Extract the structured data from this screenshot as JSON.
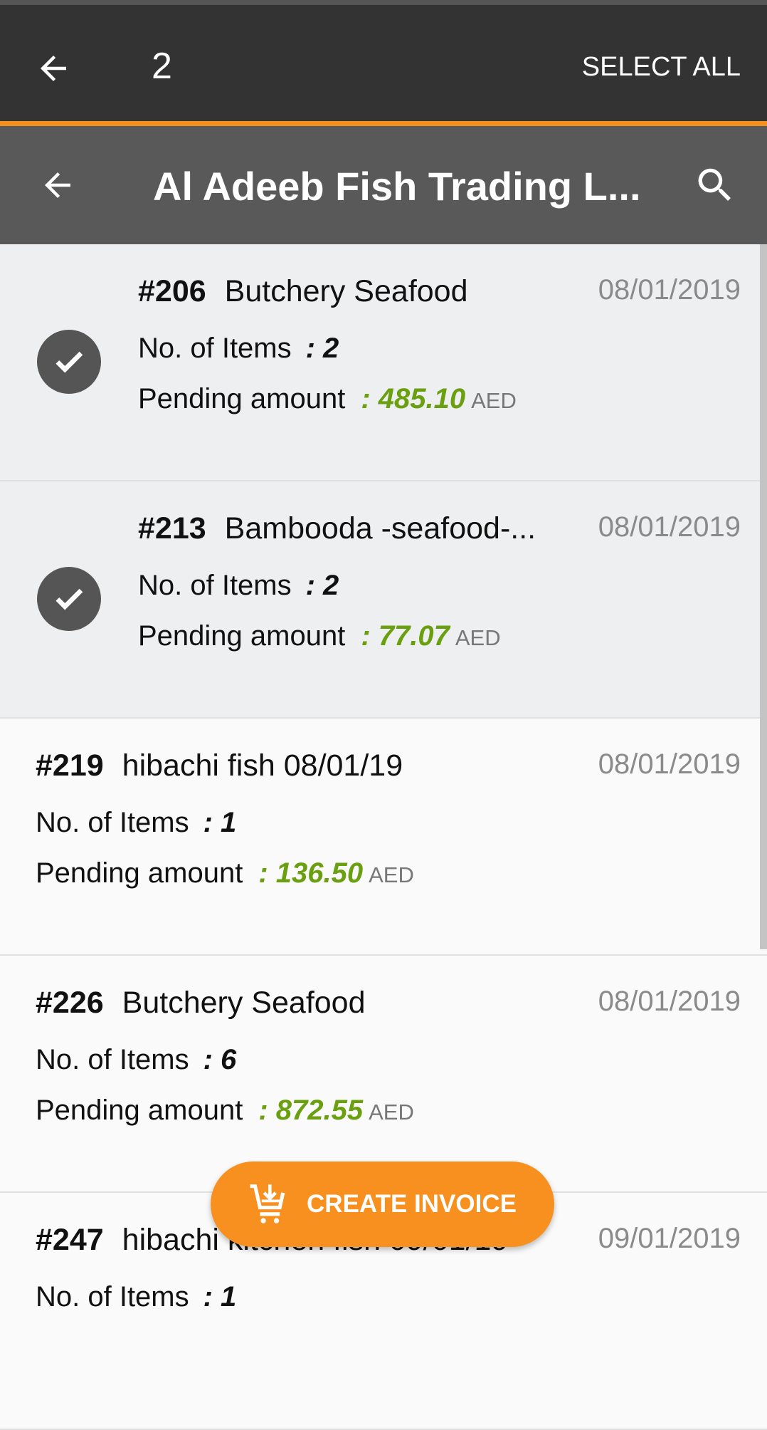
{
  "action_bar": {
    "selected_count": "2",
    "select_all_label": "SELECT ALL"
  },
  "toolbar": {
    "title": "Al Adeeb Fish Trading L..."
  },
  "labels": {
    "items": "No. of Items",
    "pending": "Pending amount",
    "currency": "AED"
  },
  "colors": {
    "accent": "#f39020",
    "amount": "#6aa00f",
    "action_bar": "#333333",
    "toolbar": "#595959"
  },
  "orders": [
    {
      "id": "#206",
      "name": "Butchery Seafood",
      "date": "08/01/2019",
      "items": ": 2",
      "amount": ": 485.10",
      "selected": true
    },
    {
      "id": "#213",
      "name": "Bambooda -seafood-...",
      "date": "08/01/2019",
      "items": ": 2",
      "amount": ": 77.07",
      "selected": true
    },
    {
      "id": "#219",
      "name": "hibachi fish 08/01/19",
      "date": "08/01/2019",
      "items": ": 1",
      "amount": ": 136.50",
      "selected": false
    },
    {
      "id": "#226",
      "name": "Butchery Seafood",
      "date": "08/01/2019",
      "items": ": 6",
      "amount": ": 872.55",
      "selected": false
    },
    {
      "id": "#247",
      "name": "hibachi kitchen fish 09/01/19",
      "date": "09/01/2019",
      "items": ": 1",
      "amount": "",
      "selected": false
    }
  ],
  "fab": {
    "label": "CREATE INVOICE",
    "icon": "cart-download-icon"
  }
}
